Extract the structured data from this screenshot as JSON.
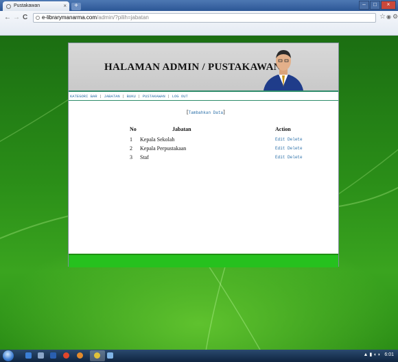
{
  "browser": {
    "tab_title": "Pustakawan",
    "tab_close": "×",
    "new_tab": "+",
    "url_host": "e-librarymanarma.com",
    "url_path": "/admin/?pilih=jabatan",
    "window_buttons": {
      "minimize": "–",
      "maximize": "□",
      "close": "×"
    },
    "nav": {
      "back": "←",
      "forward": "→",
      "reload": "C"
    }
  },
  "header": {
    "title": "HALAMAN ADMIN / PUSTAKAWAN"
  },
  "menu": {
    "items": [
      {
        "label": "KATEGORI BAR"
      },
      {
        "label": "JABATAN"
      },
      {
        "label": "BUKU"
      },
      {
        "label": "PUSTAKAWAN"
      },
      {
        "label": "LOG OUT"
      }
    ],
    "separator": "|"
  },
  "content": {
    "add_link": "Tambahkan Data",
    "table": {
      "headers": {
        "no": "No",
        "jabatan": "Jabatan",
        "action": "Action"
      },
      "rows": [
        {
          "no": "1",
          "jabatan": "Kepala Sekolah",
          "edit": "Edit",
          "delete": "Delete"
        },
        {
          "no": "2",
          "jabatan": "Kepala Perpustakaan",
          "edit": "Edit",
          "delete": "Delete"
        },
        {
          "no": "3",
          "jabatan": "Staf",
          "edit": "Edit",
          "delete": "Delete"
        }
      ]
    }
  },
  "taskbar": {
    "clock": "6:01"
  },
  "colors": {
    "link": "#2a6fa8",
    "accent_green": "#26c11e",
    "banner_gray": "#d0d0d0"
  }
}
